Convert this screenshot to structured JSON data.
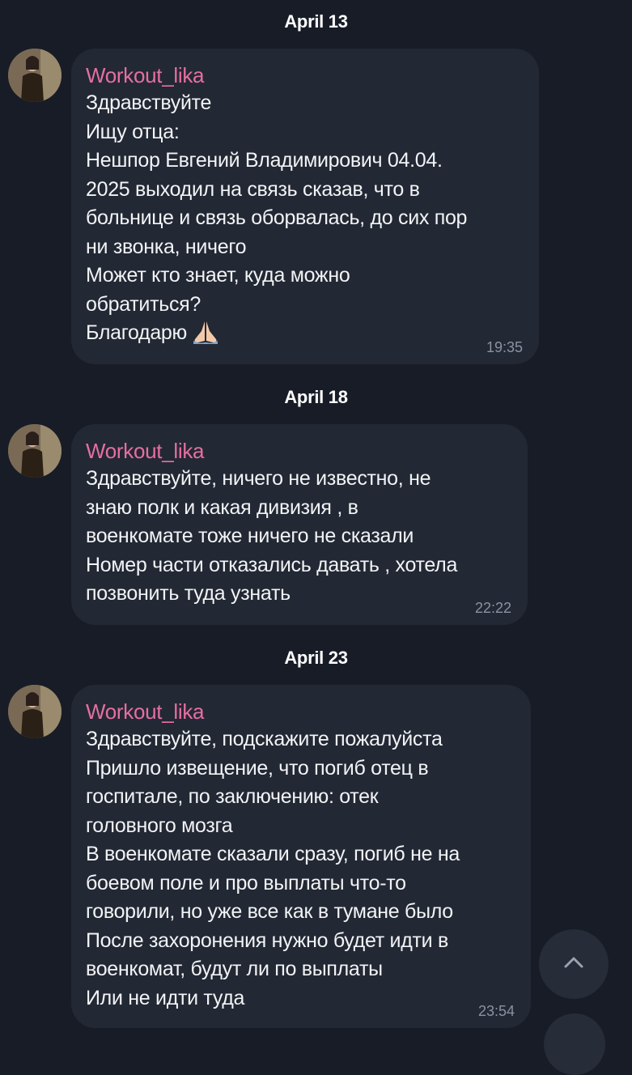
{
  "groups": [
    {
      "date": "April 13",
      "sender": "Workout_lika",
      "lines": [
        "Здравствуйте",
        "Ищу отца:",
        "Нешпор Евгений Владимирович 04.04.",
        "2025 выходил на связь сказав, что в",
        "больнице и связь оборвалась, до сих пор",
        "ни звонка, ничего",
        "Может кто знает, куда можно",
        "обратиться?",
        "Благодарю"
      ],
      "emoji": "praying-hands",
      "time": "19:35"
    },
    {
      "date": "April 18",
      "sender": "Workout_lika",
      "lines": [
        "Здравствуйте, ничего не известно, не",
        "знаю полк и какая дивизия , в",
        "военкомате тоже ничего не сказали",
        "Номер части отказались давать , хотела",
        "позвонить туда узнать"
      ],
      "time": "22:22"
    },
    {
      "date": "April 23",
      "sender": "Workout_lika",
      "lines": [
        "Здравствуйте, подскажите пожалуйста",
        "Пришло извещение, что погиб отец в",
        "госпитале, по заключению: отек",
        "головного мозга",
        "В военкомате сказали сразу, погиб не на",
        "боевом поле и про выплаты что-то",
        "говорили, но уже все как в тумане было",
        "После захоронения нужно будет идти в",
        "военкомат, будут ли по  выплаты",
        "Или не идти туда"
      ],
      "time": "23:54"
    }
  ],
  "scroll_button": {
    "icon": "chevron-up-icon"
  },
  "colors": {
    "background": "#181c26",
    "bubble": "#222834",
    "sender": "#e66fa0",
    "time": "#8a93a3"
  }
}
